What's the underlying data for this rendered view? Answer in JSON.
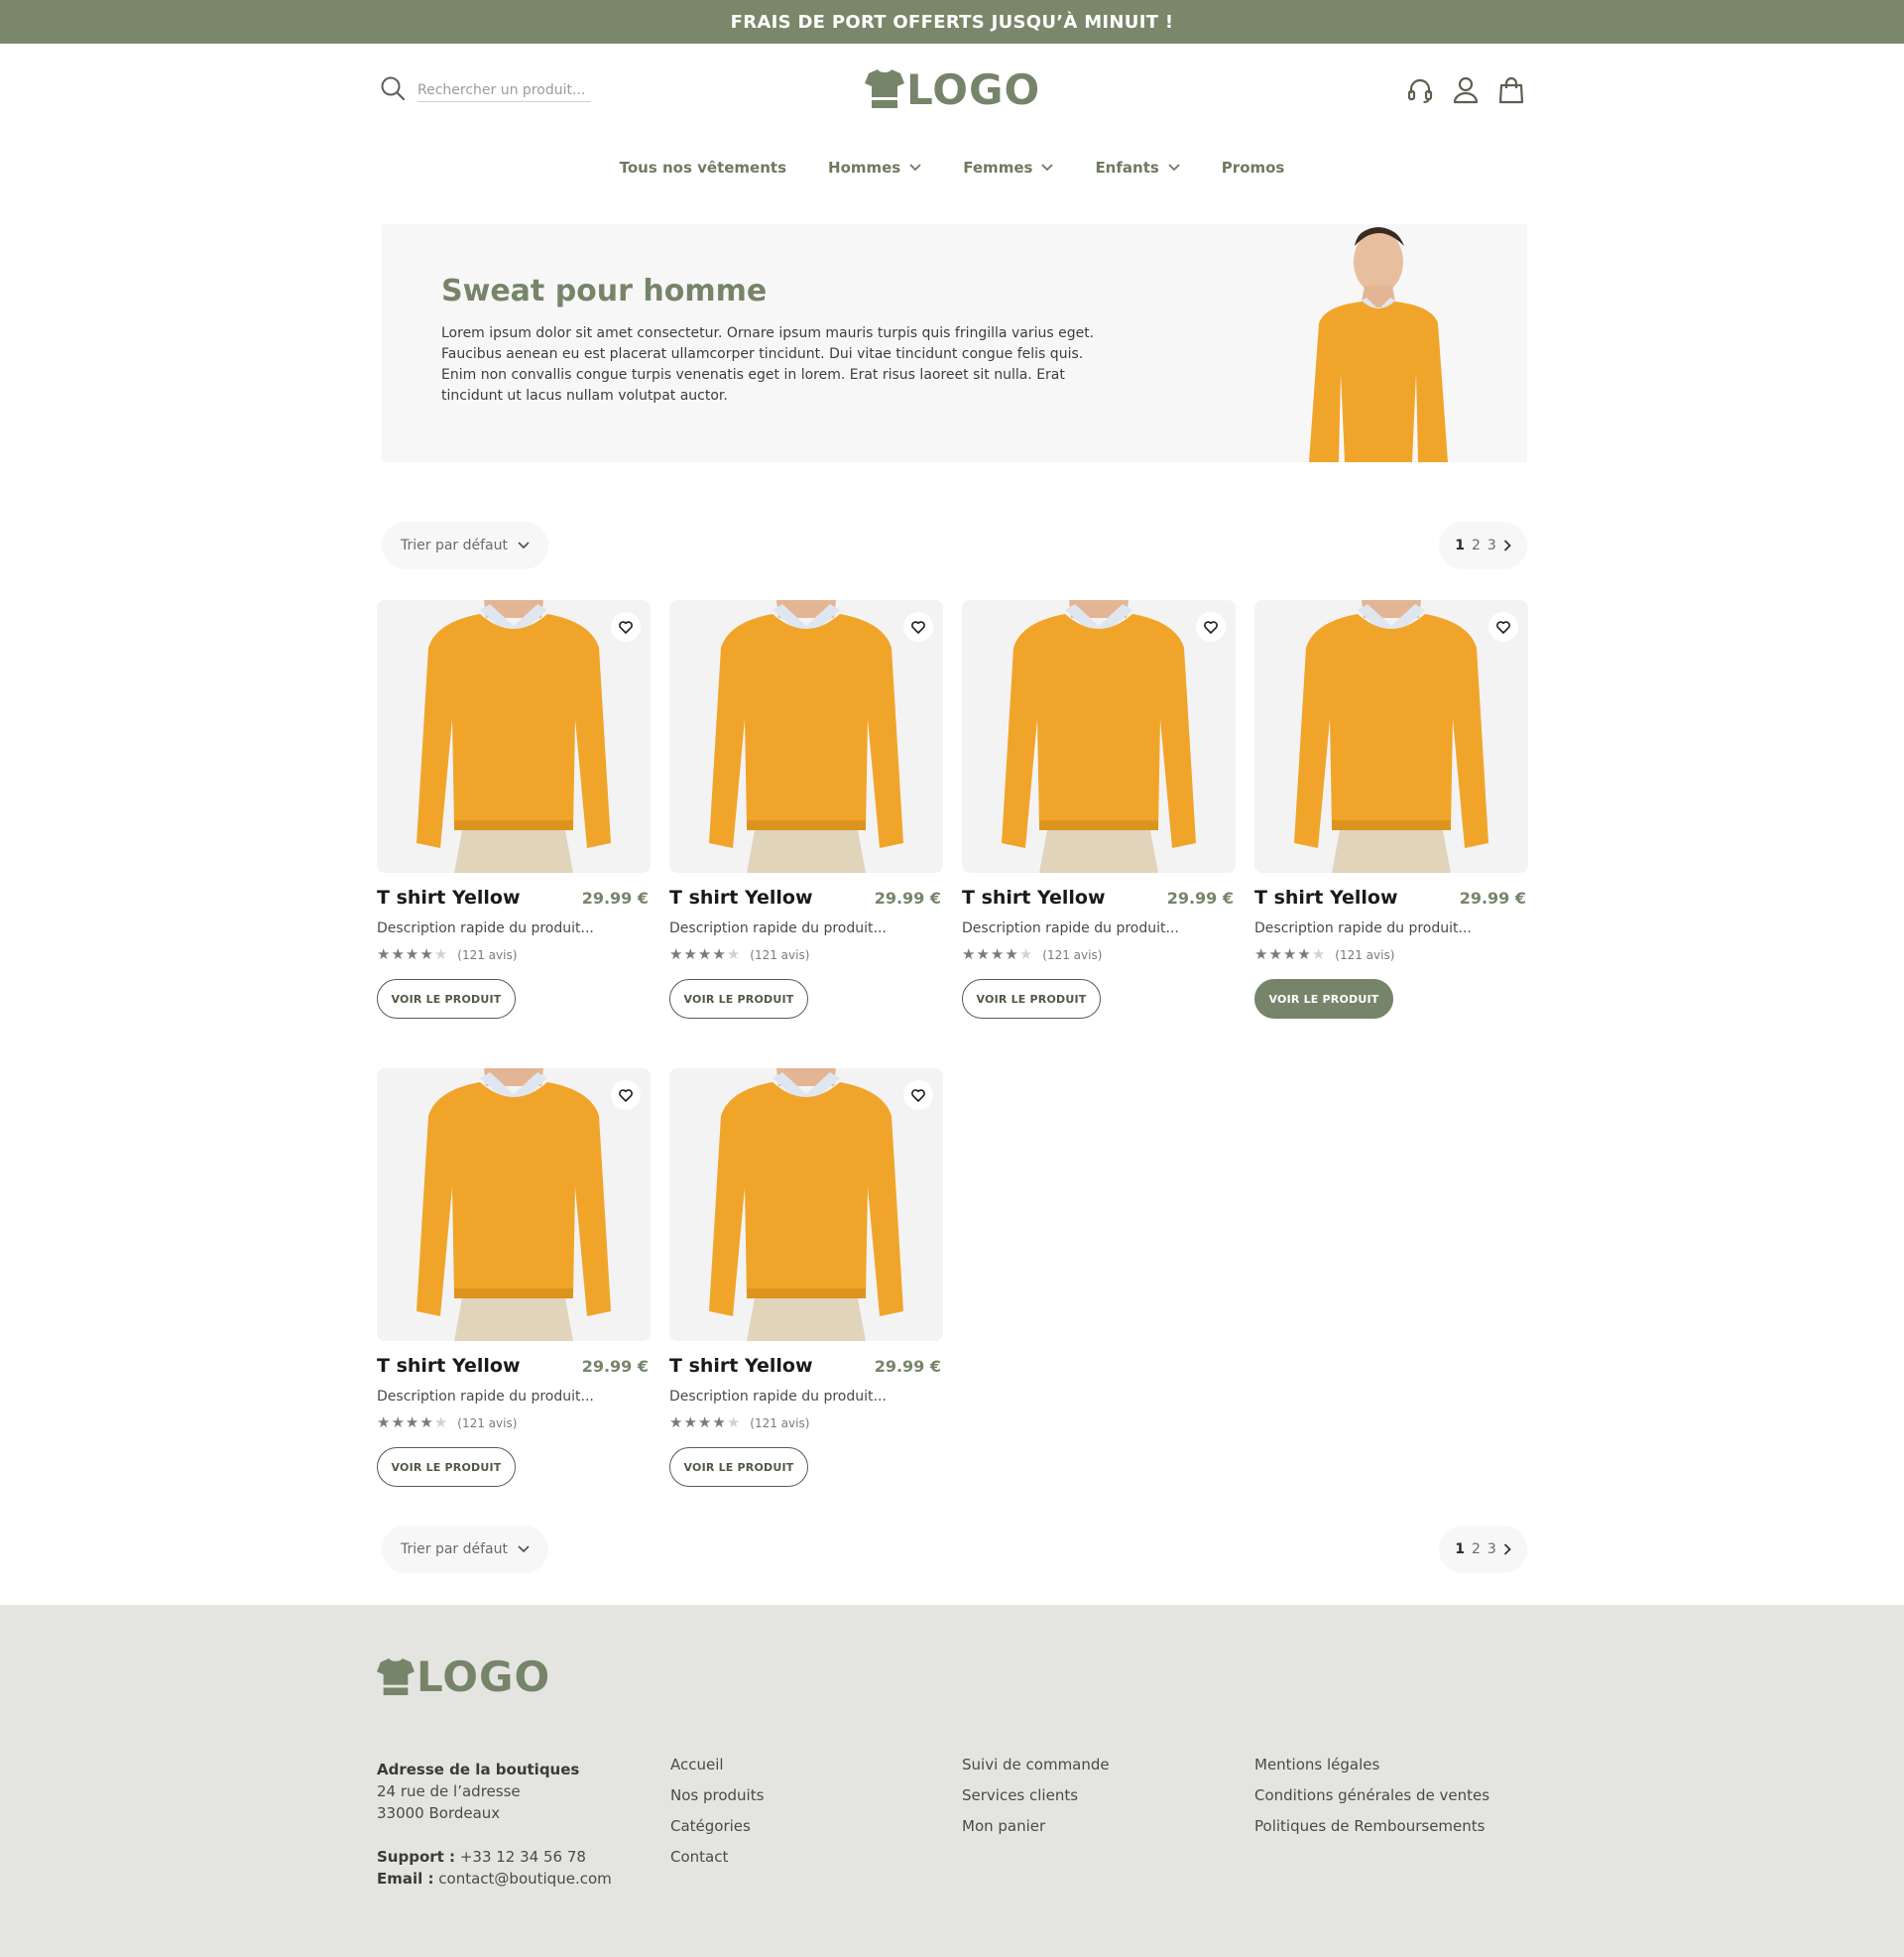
{
  "banner": {
    "text": "FRAIS DE PORT OFFERTS JUSQU’À MINUIT !"
  },
  "colors": {
    "brand": "#76856a",
    "banner": "#7a876a",
    "footer_bg": "#e4e5e1",
    "sweater": "#f0a52a"
  },
  "search": {
    "placeholder": "Rechercher un produit..."
  },
  "logo": {
    "text": "LOGO"
  },
  "header_icons": [
    "headset-icon",
    "user-icon",
    "shopping-bag-icon"
  ],
  "nav": {
    "items": [
      {
        "label": "Tous nos vêtements",
        "dropdown": false
      },
      {
        "label": "Hommes",
        "dropdown": true
      },
      {
        "label": "Femmes",
        "dropdown": true
      },
      {
        "label": "Enfants",
        "dropdown": true
      },
      {
        "label": "Promos",
        "dropdown": false
      }
    ]
  },
  "hero": {
    "title": "Sweat pour homme",
    "text": "Lorem ipsum dolor sit amet consectetur. Ornare ipsum mauris turpis quis fringilla varius eget. Faucibus aenean eu est placerat ullamcorper tincidunt. Dui vitae tincidunt congue felis quis. Enim non convallis congue turpis venenatis eget in lorem. Erat risus laoreet sit nulla. Erat tincidunt ut lacus nullam volutpat auctor."
  },
  "toolbar": {
    "sort_label": "Trier par défaut",
    "pages": [
      "1",
      "2",
      "3"
    ],
    "current_page": "1"
  },
  "products": [
    {
      "name": "T shirt Yellow",
      "price": "29.99 €",
      "description": "Description rapide du produit...",
      "rating": 4,
      "reviews": "(121 avis)",
      "button": "VOIR LE PRODUIT",
      "highlighted": false
    },
    {
      "name": "T shirt Yellow",
      "price": "29.99 €",
      "description": "Description rapide du produit...",
      "rating": 4,
      "reviews": "(121 avis)",
      "button": "VOIR LE PRODUIT",
      "highlighted": false
    },
    {
      "name": "T shirt Yellow",
      "price": "29.99 €",
      "description": "Description rapide du produit...",
      "rating": 4,
      "reviews": "(121 avis)",
      "button": "VOIR LE PRODUIT",
      "highlighted": false
    },
    {
      "name": "T shirt Yellow",
      "price": "29.99 €",
      "description": "Description rapide du produit...",
      "rating": 4,
      "reviews": "(121 avis)",
      "button": "VOIR LE PRODUIT",
      "highlighted": true
    },
    {
      "name": "T shirt Yellow",
      "price": "29.99 €",
      "description": "Description rapide du produit...",
      "rating": 4,
      "reviews": "(121 avis)",
      "button": "VOIR LE PRODUIT",
      "highlighted": false
    },
    {
      "name": "T shirt Yellow",
      "price": "29.99 €",
      "description": "Description rapide du produit...",
      "rating": 4,
      "reviews": "(121 avis)",
      "button": "VOIR LE PRODUIT",
      "highlighted": false
    }
  ],
  "footer": {
    "address_title": "Adresse de la boutiques",
    "address_line1": "24 rue de l’adresse",
    "address_line2": "33000 Bordeaux",
    "support_label": "Support :",
    "support_value": "+33 12 34 56 78",
    "email_label": "Email :",
    "email_value": "contact@boutique.com",
    "col1": [
      "Accueil",
      "Nos produits",
      "Catégories",
      "Contact"
    ],
    "col2": [
      "Suivi de commande",
      "Services clients",
      "Mon panier"
    ],
    "col3": [
      "Mentions légales",
      "Conditions générales de ventes",
      "Politiques de Remboursements"
    ]
  }
}
